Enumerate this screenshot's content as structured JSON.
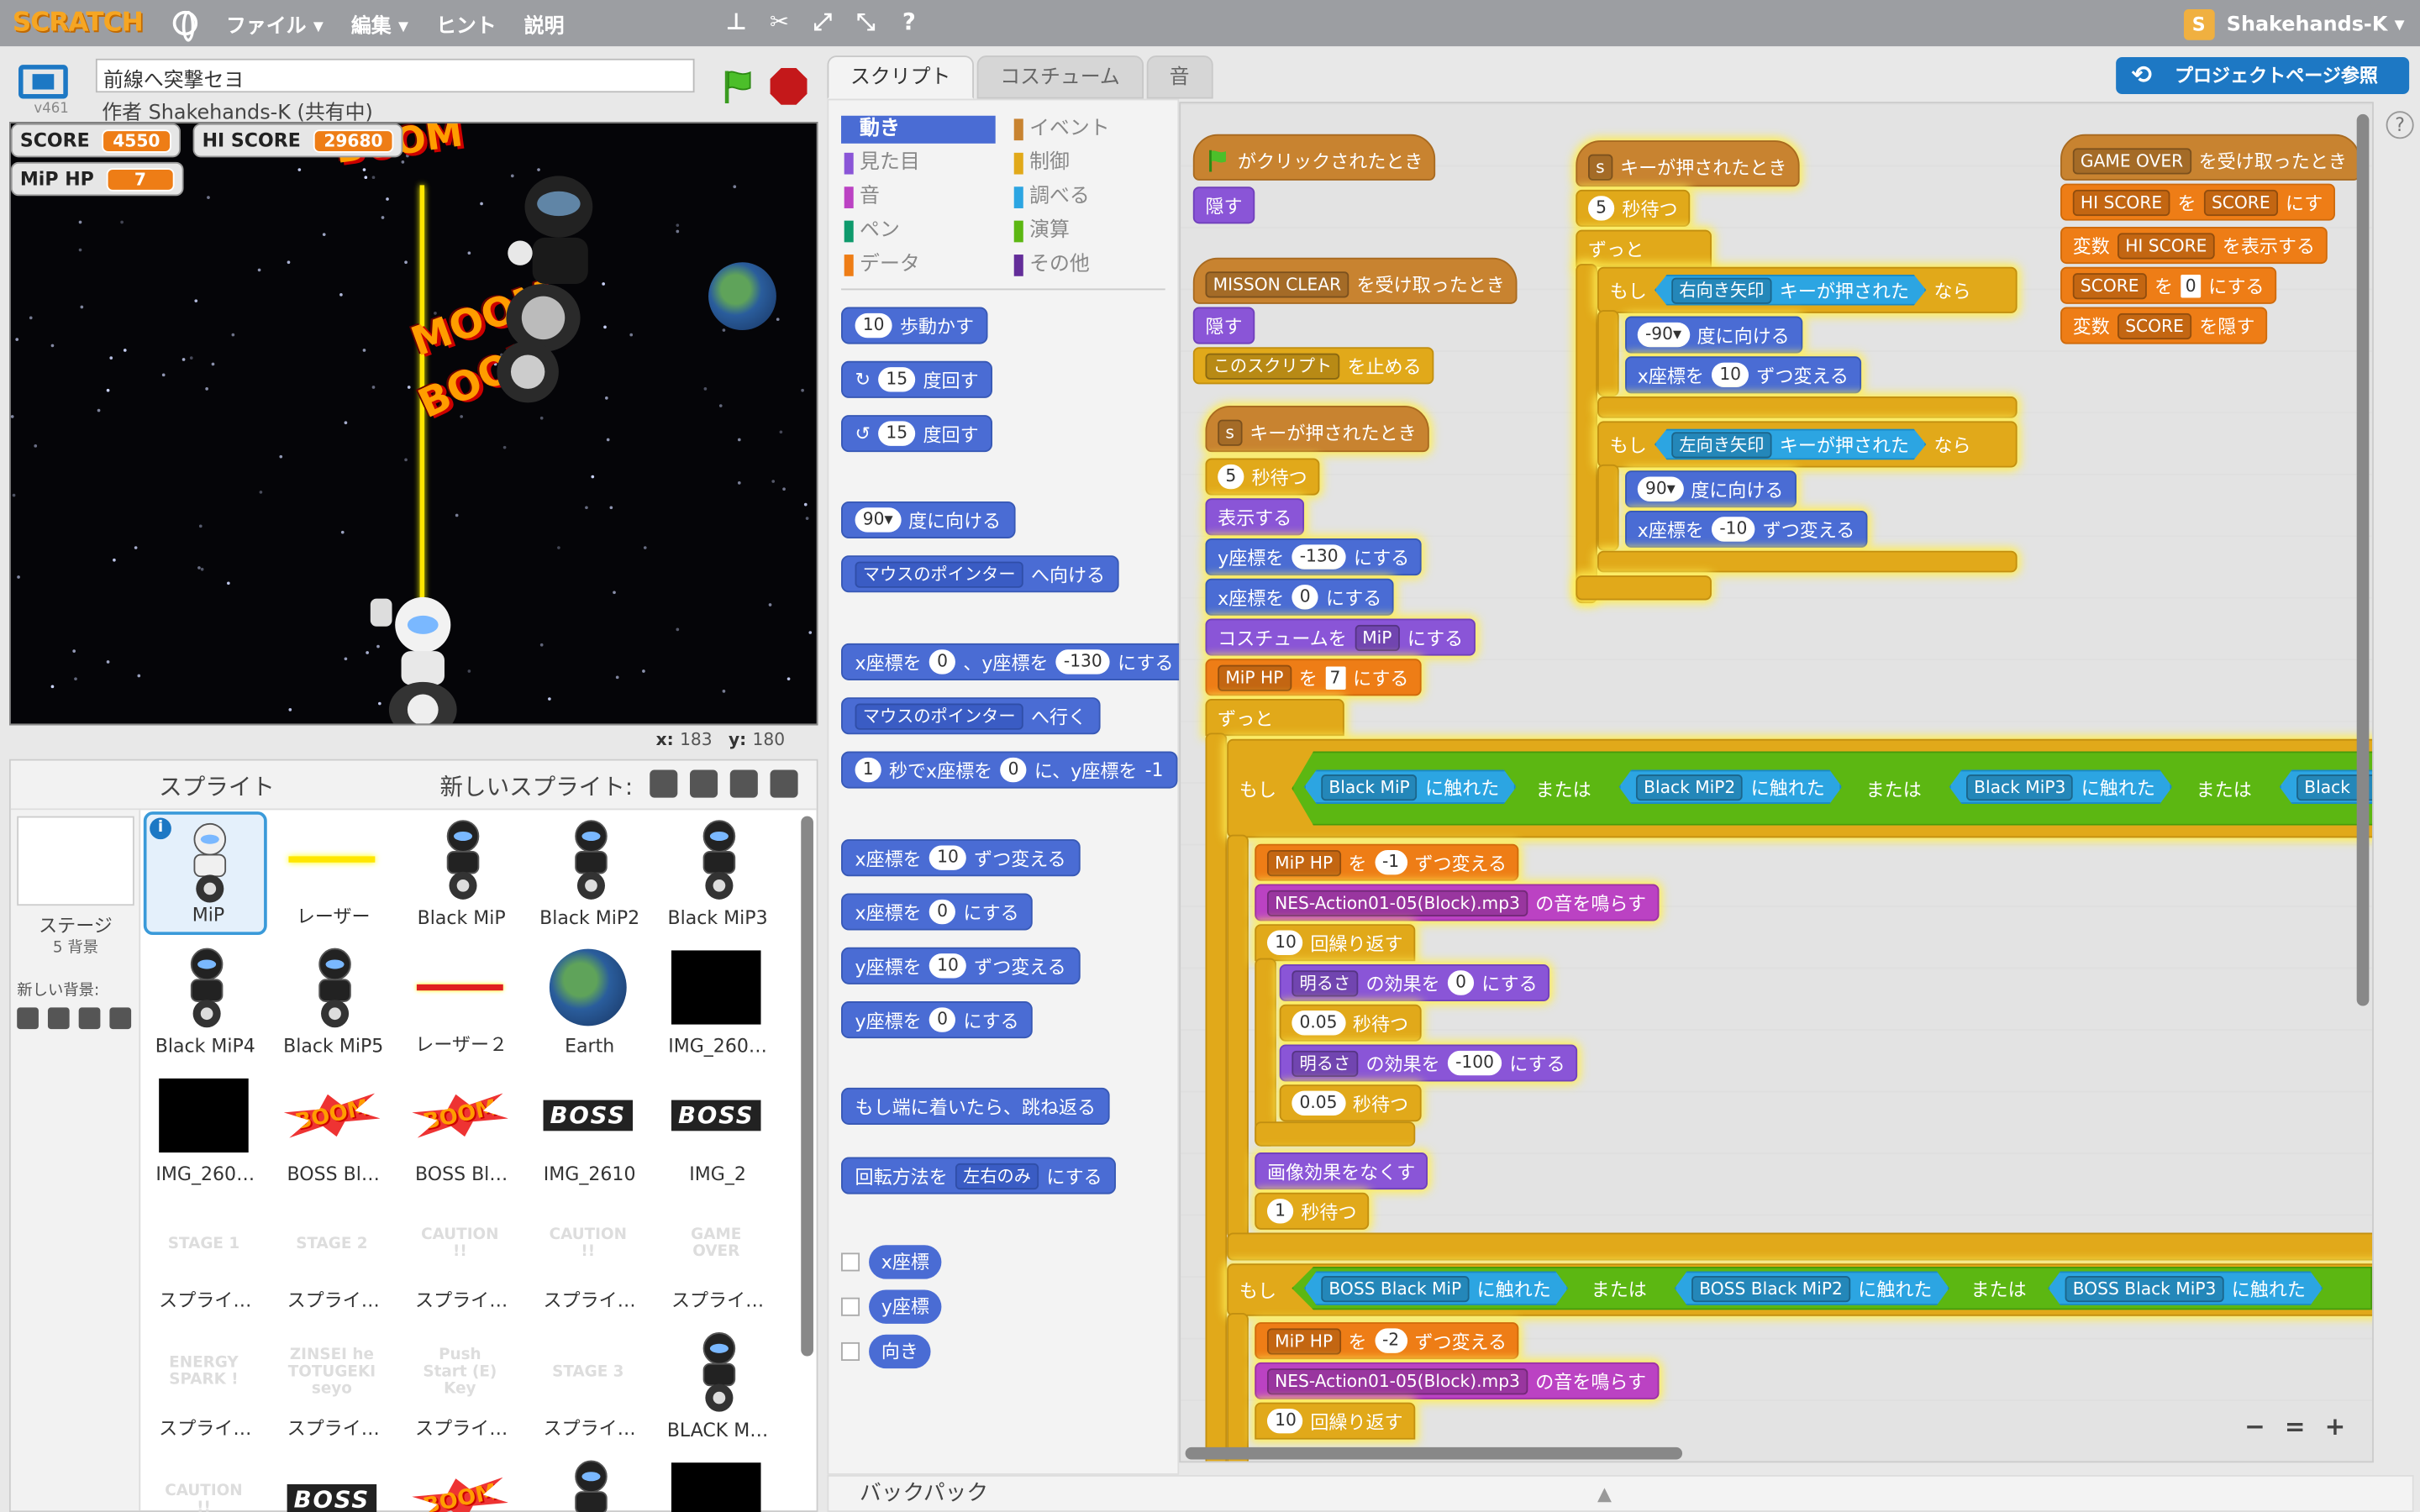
{
  "menu": {
    "logo": "SCRATCH",
    "file": "ファイル ▾",
    "edit": "編集 ▾",
    "tips": "ヒント",
    "about": "説明",
    "user": "Shakehands-K ▾"
  },
  "stage": {
    "version": "v461",
    "title": "前線へ突撃セヨ",
    "author": "作者 Shakehands-K (共有中)",
    "coords_x_label": "x:",
    "coords_x": "183",
    "coords_y_label": "y:",
    "coords_y": "180",
    "monitors": [
      {
        "label": "SCORE",
        "value": "4550"
      },
      {
        "label": "HI SCORE",
        "value": "29680"
      },
      {
        "label": "MiP HP",
        "value": "7"
      }
    ],
    "boom_texts": [
      "BOOM",
      "MOOM",
      "BOOM"
    ]
  },
  "sprites": {
    "header": "スプライト",
    "new_sprite": "新しいスプライト:",
    "stage_label": "ステージ",
    "stage_sub": "5 背景",
    "new_backdrop": "新しい背景:",
    "items": [
      {
        "name": "MiP",
        "kind": "robot",
        "selected": true
      },
      {
        "name": "レーザー",
        "kind": "laser-y"
      },
      {
        "name": "Black MiP",
        "kind": "robot-b"
      },
      {
        "name": "Black MiP2",
        "kind": "robot-b"
      },
      {
        "name": "Black MiP3",
        "kind": "robot-b"
      },
      {
        "name": "Black MiP4",
        "kind": "robot-b"
      },
      {
        "name": "Black MiP5",
        "kind": "robot-b"
      },
      {
        "name": "レーザー２",
        "kind": "laser-r"
      },
      {
        "name": "Earth",
        "kind": "earth"
      },
      {
        "name": "IMG_260…",
        "kind": "space"
      },
      {
        "name": "IMG_260…",
        "kind": "space"
      },
      {
        "name": "BOSS Bl…",
        "kind": "boom"
      },
      {
        "name": "BOSS Bl…",
        "kind": "boom"
      },
      {
        "name": "IMG_2610",
        "kind": "bosslogo"
      },
      {
        "name": "IMG_2",
        "kind": "bosslogo"
      },
      {
        "name": "スプライ…",
        "kind": "text",
        "text": "STAGE 1"
      },
      {
        "name": "スプライ…",
        "kind": "text",
        "text": "STAGE 2"
      },
      {
        "name": "スプライ…",
        "kind": "text",
        "text": "CAUTION !!"
      },
      {
        "name": "スプライ…",
        "kind": "text",
        "text": "CAUTION !!"
      },
      {
        "name": "スプライ…",
        "kind": "text",
        "text": "GAME OVER"
      },
      {
        "name": "スプライ…",
        "kind": "text",
        "text": "ENERGY SPARK !"
      },
      {
        "name": "スプライ…",
        "kind": "text",
        "text": "ZINSEI he TOTUGEKI seyo"
      },
      {
        "name": "スプライ…",
        "kind": "text",
        "text": "Push Start (E) Key"
      },
      {
        "name": "スプライ…",
        "kind": "text",
        "text": "STAGE 3"
      },
      {
        "name": "BLACK M…",
        "kind": "robot-b"
      },
      {
        "name": "",
        "kind": "text",
        "text": "CAUTION !!"
      },
      {
        "name": "",
        "kind": "bosslogo"
      },
      {
        "name": "",
        "kind": "boom"
      },
      {
        "name": "",
        "kind": "robot-b"
      },
      {
        "name": "",
        "kind": "space"
      }
    ]
  },
  "tabs": {
    "scripts": "スクリプト",
    "costumes": "コスチューム",
    "sounds": "音"
  },
  "project_page": "プロジェクトページ参照",
  "help": "?",
  "categories": [
    {
      "label": "動き",
      "color": "#4a6cd4",
      "active": true
    },
    {
      "label": "イベント",
      "color": "#c88330"
    },
    {
      "label": "見た目",
      "color": "#8a55d7"
    },
    {
      "label": "制御",
      "color": "#e1a91a"
    },
    {
      "label": "音",
      "color": "#bb42c3"
    },
    {
      "label": "調べる",
      "color": "#2ca5e2"
    },
    {
      "label": "ペン",
      "color": "#0e9a6c"
    },
    {
      "label": "演算",
      "color": "#5cb712"
    },
    {
      "label": "データ",
      "color": "#ee7d16"
    },
    {
      "label": "その他",
      "color": "#632d99"
    }
  ],
  "palette": {
    "move": {
      "val": "10",
      "t": "歩動かす"
    },
    "turn_r": {
      "val": "15",
      "t": "度回す"
    },
    "turn_l": {
      "val": "15",
      "t": "度回す"
    },
    "point_dir": {
      "val": "90▾",
      "t": "度に向ける"
    },
    "point_towards": {
      "dd": "マウスのポインター",
      "t": "へ向ける"
    },
    "goto_xy": {
      "t1": "x座標を",
      "v1": "0",
      "t2": "、y座標を",
      "v2": "-130",
      "t3": "にする"
    },
    "goto": {
      "dd": "マウスのポインター",
      "t": "へ行く"
    },
    "glide": {
      "v1": "1",
      "t1": "秒でx座標を",
      "v2": "0",
      "t2": "に、y座標を",
      "v3": "-1"
    },
    "change_x": {
      "t1": "x座標を",
      "v": "10",
      "t2": "ずつ変える"
    },
    "set_x": {
      "t1": "x座標を",
      "v": "0",
      "t2": "にする"
    },
    "change_y": {
      "t1": "y座標を",
      "v": "10",
      "t2": "ずつ変える"
    },
    "set_y": {
      "t1": "y座標を",
      "v": "0",
      "t2": "にする"
    },
    "bounce": "もし端に着いたら、跳ね返る",
    "rotation": {
      "t1": "回転方法を",
      "dd": "左右のみ",
      "t2": "にする"
    },
    "rep_x": "x座標",
    "rep_y": "y座標",
    "rep_dir": "向き"
  },
  "scripts": {
    "s1_hat": "がクリックされたとき",
    "s1_hide": "隠す",
    "s2_hat_dd": "MISSON CLEAR",
    "s2_hat_t": "を受け取ったとき",
    "s2_hide": "隠す",
    "s2_stop_dd": "このスクリプト",
    "s2_stop_t": "を止める",
    "s3_key": "s",
    "s3_hat_t": "キーが押されたとき",
    "s3_wait_v": "5",
    "s3_wait_t": "秒待つ",
    "s3_show": "表示する",
    "s3_sety_t1": "y座標を",
    "s3_sety_v": "-130",
    "s3_sety_t2": "にする",
    "s3_setx_t1": "x座標を",
    "s3_setx_v": "0",
    "s3_setx_t2": "にする",
    "s3_cos_t1": "コスチュームを",
    "s3_cos_dd": "MiP",
    "s3_cos_t2": "にする",
    "s3_hp_dd": "MiP HP",
    "s3_hp_t1": "を",
    "s3_hp_v": "7",
    "s3_hp_t2": "にする",
    "forever": "ずっと",
    "if": "もし",
    "or": "または",
    "touching": "に触れた",
    "if1_a": "Black MiP",
    "if1_b": "Black MiP2",
    "if1_c": "Black MiP3",
    "if1_d": "Black M",
    "chg_hp_dd": "MiP HP",
    "chg_hp_t1": "を",
    "chg_hp_v1": "-1",
    "chg_hp_t2": "ずつ変える",
    "sound_dd": "NES-Action01-05(Block).mp3",
    "sound_t": "の音を鳴らす",
    "repeat_v": "10",
    "repeat_t": "回繰り返す",
    "fx_dd": "明るさ",
    "fx_t1": "の効果を",
    "fx_v1": "0",
    "fx_t2": "にする",
    "wait_v": "0.05",
    "wait_t": "秒待つ",
    "fx_v2": "-100",
    "clear_fx": "画像効果をなくす",
    "wait1_v": "1",
    "wait1_t": "秒待つ",
    "if2_a": "BOSS Black MiP",
    "if2_b": "BOSS Black MiP2",
    "if2_c": "BOSS Black MiP3",
    "chg_hp_v2": "-2",
    "s4_key": "s",
    "s4_hat_t": "キーが押されたとき",
    "s4_wait_v": "5",
    "s4_wait_t": "秒待つ",
    "s4_if_key1": "右向き矢印",
    "s4_if_t": "キーが押された",
    "then": "なら",
    "s4_dir1": "-90▾",
    "s4_dir_t": "度に向ける",
    "s4_chx_t1": "x座標を",
    "s4_chx_v1": "10",
    "s4_chx_t2": "ずつ変える",
    "s4_if_key2": "左向き矢印",
    "s4_dir2": "90▾",
    "s4_chx_v2": "-10",
    "s5_hat_dd": "GAME OVER",
    "s5_hat_t": "を受け取ったとき",
    "s5_set_dd": "HI SCORE",
    "s5_set_t1": "を",
    "s5_set_rep": "SCORE",
    "s5_set_t2": "にす",
    "s5_show_t1": "変数",
    "s5_show_dd": "HI SCORE",
    "s5_show_t2": "を表示する",
    "s5_sc_dd": "SCORE",
    "s5_sc_t1": "を",
    "s5_sc_v": "0",
    "s5_sc_t2": "にする",
    "s5_hide_t1": "変数",
    "s5_hide_dd": "SCORE",
    "s5_hide_t2": "を隠す"
  },
  "backpack": "バックパック",
  "zoom": {
    "out": "−",
    "reset": "=",
    "in": "+"
  }
}
